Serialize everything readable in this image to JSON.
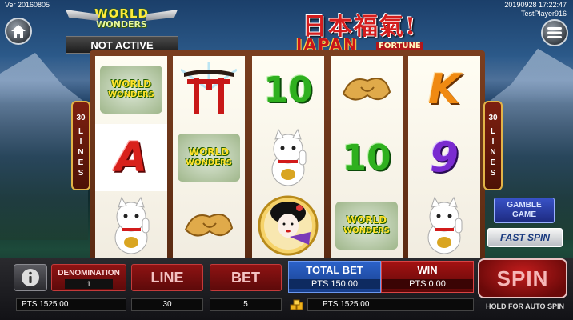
{
  "header": {
    "version": "Ver 20160805",
    "datetime": "20190928 17:22:47",
    "player": "TestPlayer916",
    "status": "NOT ACTIVE"
  },
  "logos": {
    "world_wonders_line1": "WORLD",
    "world_wonders_line2": "WONDERS",
    "japan_kanji": "日本福氣!",
    "japan_title": "JAPAN",
    "japan_subtitle": "FORTUNE"
  },
  "lines_badge": {
    "count": "30",
    "word": "LINES"
  },
  "reels": [
    [
      "world-wonders",
      "letter-A",
      "lucky-cat"
    ],
    [
      "torii-gate",
      "world-wonders",
      "fortune-cookie"
    ],
    [
      "ten",
      "lucky-cat",
      "geisha"
    ],
    [
      "fortune-cookie",
      "ten",
      "world-wonders"
    ],
    [
      "letter-K",
      "nine",
      "lucky-cat"
    ]
  ],
  "symbols": {
    "ten": "10",
    "nine": "9",
    "letter_A": "A",
    "letter_K": "K"
  },
  "buttons": {
    "gamble_line1": "GAMBLE",
    "gamble_line2": "GAME",
    "fast_spin": "FAST SPIN",
    "spin": "SPIN",
    "hold_hint": "HOLD FOR AUTO SPIN"
  },
  "bottom_bar": {
    "denomination_label": "DENOMINATION",
    "denomination_value": "1",
    "line_label": "LINE",
    "line_value": "30",
    "bet_label": "BET",
    "bet_value": "5",
    "total_bet_label": "TOTAL BET",
    "total_bet_value": "PTS 150.00",
    "win_label": "WIN",
    "win_value": "PTS 0.00",
    "credit_left": "PTS 1525.00",
    "credit_right": "PTS 1525.00"
  },
  "colors": {
    "accent_red": "#8f1313",
    "accent_blue": "#2c62c9",
    "ten_green": "#2fb01f",
    "letter_A": "#d8211b",
    "letter_K": "#f08a12",
    "nine_purple": "#7a2bd0"
  }
}
